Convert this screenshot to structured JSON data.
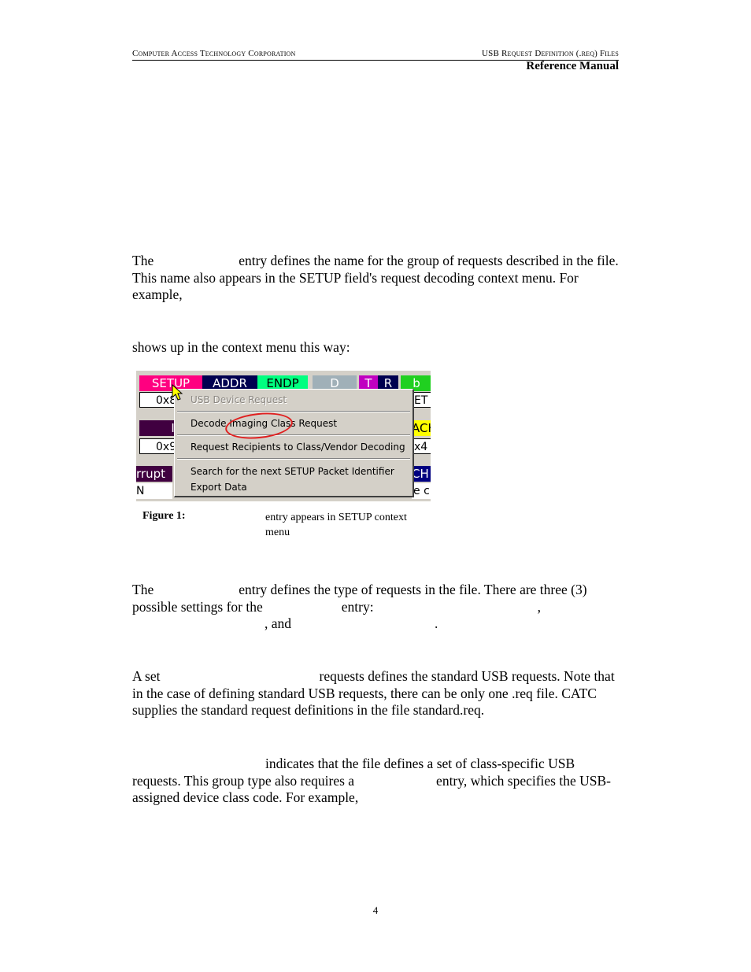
{
  "header": {
    "left": "Computer Access Technology Corporation",
    "right": "USB Request Definition (.req) Files",
    "subtitle": "Reference Manual"
  },
  "paragraphs": {
    "p1_start": "The",
    "p1_rest": "entry defines the name for the group of requests described in the file. This name also appears in the SETUP field's request decoding context menu. For example,",
    "p2": "shows up in the context menu this way:",
    "p3_start": "The",
    "p3_mid": "entry defines the type of requests in the file. There are three (3) possible settings for the",
    "p3_entry": "entry:",
    "p3_comma": ",",
    "p3_and": ", and",
    "p3_period": ".",
    "p4_start": "A set",
    "p4_rest": "requests defines the standard USB requests. Note that in the case of defining standard USB requests, there can be only one .req file. CATC supplies the standard request definitions in the file standard.req.",
    "p5_rest": "indicates that the file defines a set of class-specific USB requests.  This group type also requires a",
    "p5_end": "entry, which specifies the USB-assigned device class code.  For example,"
  },
  "figure": {
    "fields": [
      {
        "label": "SETUP",
        "bg": "#ff0080",
        "fg": "#ffffff"
      },
      {
        "label": "ADDR",
        "bg": "#000050",
        "fg": "#ffffff"
      },
      {
        "label": "ENDP",
        "bg": "#00ff80",
        "fg": "#000000"
      },
      {
        "label": "D",
        "bg": "#a0b0b8",
        "fg": "#ffffff"
      },
      {
        "label": "T",
        "bg": "#c000c0",
        "fg": "#ffffff"
      },
      {
        "label": "R",
        "bg": "#000050",
        "fg": "#ffffff"
      },
      {
        "label": "b",
        "bg": "#20d020",
        "fg": "#ffffff"
      }
    ],
    "values": {
      "row1_left": "0x8",
      "row1_right": "ET",
      "row2_label": "IN",
      "row2_right_label": "ACK",
      "row2_left": "0x9",
      "row2_right": "x4",
      "row3_label": "rrupt",
      "row3_right_label": "CH",
      "row3_left": "N",
      "row3_right": "e c"
    },
    "menu_items": [
      {
        "label": "USB Device Request",
        "disabled": true
      },
      {
        "label": "Decode Imaging Class Request",
        "disabled": false
      },
      {
        "label": "Request Recipients to Class/Vendor Decoding",
        "disabled": false
      },
      {
        "label": "Search for the next SETUP Packet Identifier",
        "disabled": false
      },
      {
        "label": "Export Data",
        "disabled": false
      }
    ],
    "highlight_color": "#e02020"
  },
  "caption": {
    "label": "Figure 1:",
    "text": "entry appears in SETUP context menu"
  },
  "page_number": "4"
}
